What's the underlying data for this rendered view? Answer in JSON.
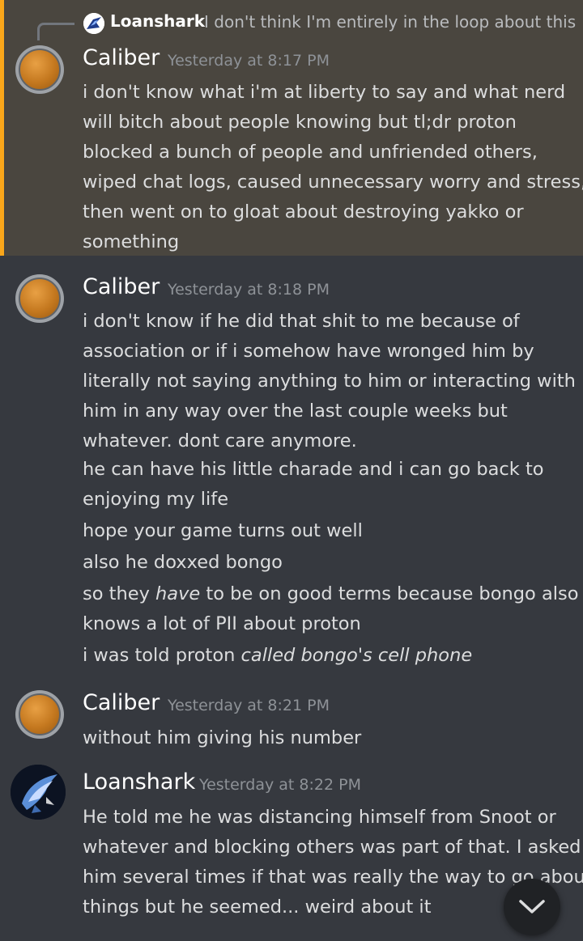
{
  "reply": {
    "author": "Loanshark",
    "text": "I don't think I'm entirely in the loop about this"
  },
  "messages": [
    {
      "author": "Caliber",
      "timestamp": "Yesterday at 8:17 PM",
      "highlighted": true,
      "lines": [
        "i don't know what i'm at liberty to say and what nerd",
        "will bitch about people knowing but tl;dr proton",
        "blocked a bunch of people and unfriended others,",
        "wiped chat logs, caused unnecessary worry and stress,",
        "then went on to gloat about destroying yakko or",
        "something"
      ]
    },
    {
      "author": "Caliber",
      "timestamp": "Yesterday at 8:18 PM",
      "lines": [
        "i don't know if he did that shit to me because of",
        "association or if i somehow have wronged him by",
        "literally not saying anything to him or interacting with",
        "him in any way over the last couple weeks but",
        "whatever.  dont care anymore.",
        "he can have his little charade and i can go back to",
        "enjoying my life",
        "hope your game turns out well",
        "also he doxxed bongo"
      ],
      "italic_line_1": {
        "before": "so they ",
        "em": "have",
        "after": " to be on good terms because bongo also"
      },
      "line_pii": "knows a lot of PII about proton",
      "italic_line_2": {
        "before": "i was told proton ",
        "em": "called bongo's cell phone",
        "after": ""
      }
    },
    {
      "author": "Caliber",
      "timestamp": "Yesterday at 8:21 PM",
      "lines": [
        "without him giving his number"
      ]
    },
    {
      "author": "Loanshark",
      "timestamp": "Yesterday at 8:22 PM",
      "lines": [
        "He told me he was distancing himself from Snoot or",
        "whatever and blocking others was part of that. I asked",
        "him several times if that was really the way to go about",
        "things but he seemed... weird about it"
      ]
    }
  ],
  "colors": {
    "background": "#36393f",
    "highlight": "#4a463f",
    "highlight_bar": "#faa61a",
    "text": "#dcddde",
    "timestamp": "#8e9297"
  },
  "icons": {
    "scroll": "chevron-down-icon",
    "reply": "reply-connector-icon"
  }
}
